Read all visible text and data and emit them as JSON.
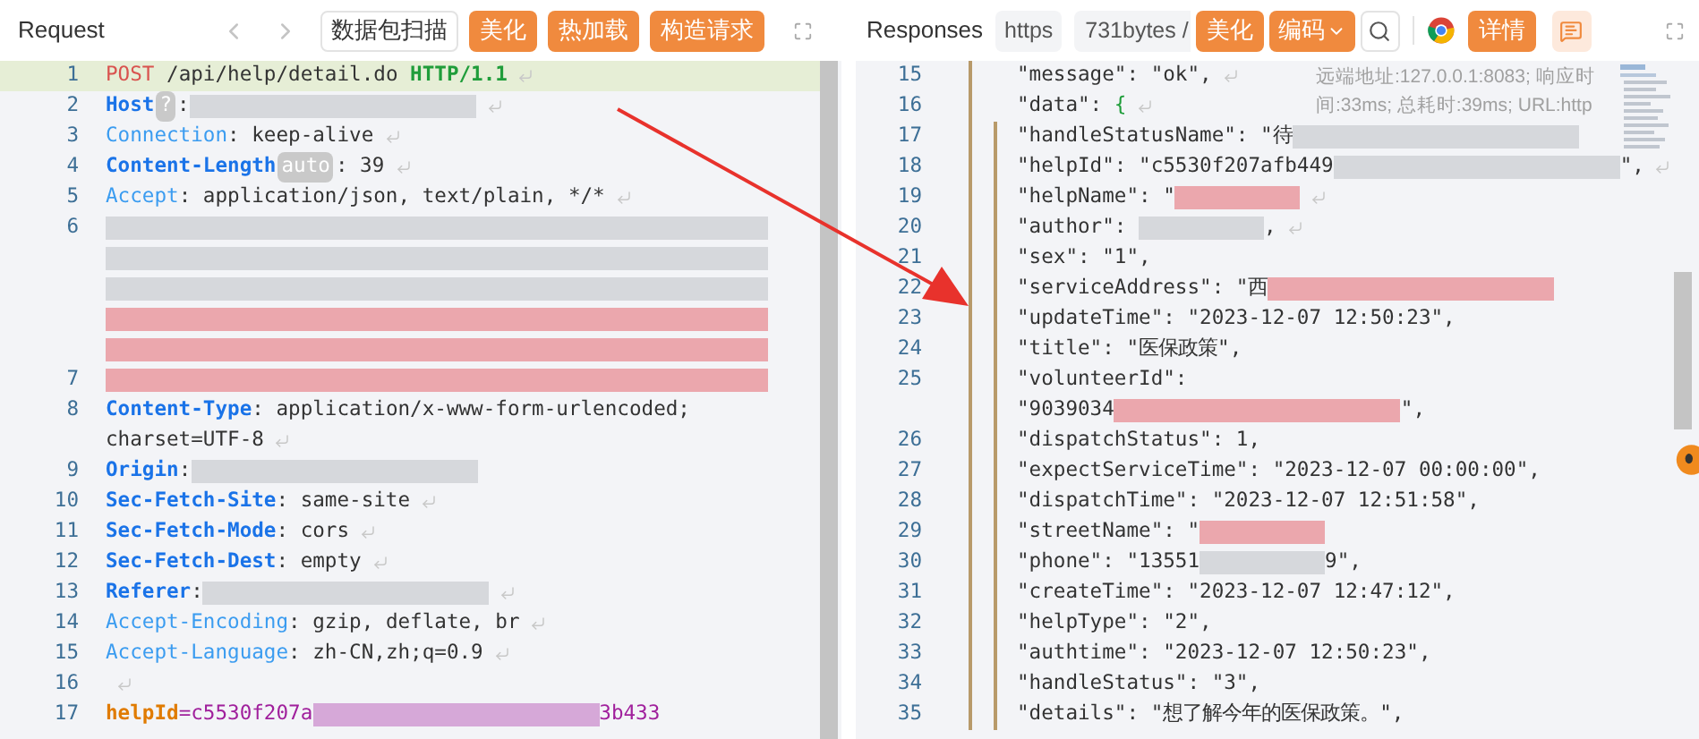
{
  "request": {
    "title": "Request",
    "buttons": [
      {
        "label": "数据包扫描",
        "kind": "outline"
      },
      {
        "label": "美化",
        "kind": "primary"
      },
      {
        "label": "热加载",
        "kind": "primary"
      },
      {
        "label": "构造请求",
        "kind": "primary"
      }
    ],
    "lines": [
      {
        "num": "1",
        "current": true,
        "eol": true,
        "segments": [
          {
            "kind": "method",
            "text": "POST"
          },
          {
            "kind": "text",
            "text": " /api/help/detail.do "
          },
          {
            "kind": "proto",
            "text": "HTTP/1.1"
          }
        ]
      },
      {
        "num": "2",
        "current": false,
        "eol": true,
        "segments": [
          {
            "kind": "key",
            "text": "Host"
          },
          {
            "kind": "badge",
            "text": "?"
          },
          {
            "kind": "text",
            "text": ":"
          },
          {
            "kind": "mask",
            "color": "#d6d8dc"
          }
        ]
      },
      {
        "num": "3",
        "current": false,
        "eol": true,
        "segments": [
          {
            "kind": "keylight",
            "text": "Connection"
          },
          {
            "kind": "text",
            "text": ": keep-alive"
          }
        ]
      },
      {
        "num": "4",
        "current": false,
        "eol": true,
        "segments": [
          {
            "kind": "key",
            "text": "Content-Length"
          },
          {
            "kind": "badge",
            "text": "auto"
          },
          {
            "kind": "text",
            "text": ": 39"
          }
        ]
      },
      {
        "num": "5",
        "current": false,
        "eol": true,
        "segments": [
          {
            "kind": "keylight",
            "text": "Accept"
          },
          {
            "kind": "text",
            "text": ": application/json, text/plain, */*"
          }
        ]
      },
      {
        "num": "6",
        "current": false,
        "eol": false,
        "segments": [
          {
            "kind": "mask_full",
            "color": "#d6d8dc"
          }
        ],
        "wraps": [
          {
            "eol": false,
            "segments": [
              {
                "kind": "mask_full",
                "color": "#d6d8dc"
              }
            ]
          },
          {
            "eol": false,
            "segments": [
              {
                "kind": "mask_full",
                "color": "#d6d8dc"
              }
            ]
          },
          {
            "eol": false,
            "segments": [
              {
                "kind": "mask_full",
                "color": "#eba7ad"
              }
            ]
          },
          {
            "eol": false,
            "segments": [
              {
                "kind": "mask_full",
                "color": "#eba7ad"
              }
            ]
          }
        ]
      },
      {
        "num": "7",
        "current": false,
        "eol": false,
        "segments": [
          {
            "kind": "mask_full",
            "color": "#eba7ad"
          }
        ]
      },
      {
        "num": "8",
        "current": false,
        "eol": false,
        "segments": [
          {
            "kind": "key",
            "text": "Content-Type"
          },
          {
            "kind": "text",
            "text": ": application/x-www-form-urlencoded; "
          }
        ],
        "wraps": [
          {
            "eol": true,
            "segments": [
              {
                "kind": "text",
                "text": "charset=UTF-8"
              }
            ]
          }
        ]
      },
      {
        "num": "9",
        "current": false,
        "eol": false,
        "segments": [
          {
            "kind": "key",
            "text": "Origin"
          },
          {
            "kind": "text",
            "text": ":"
          },
          {
            "kind": "mask",
            "color": "#d6d8dc"
          }
        ]
      },
      {
        "num": "10",
        "current": false,
        "eol": true,
        "segments": [
          {
            "kind": "key",
            "text": "Sec-Fetch-Site"
          },
          {
            "kind": "text",
            "text": ": same-site"
          }
        ]
      },
      {
        "num": "11",
        "current": false,
        "eol": true,
        "segments": [
          {
            "kind": "key",
            "text": "Sec-Fetch-Mode"
          },
          {
            "kind": "text",
            "text": ": cors"
          }
        ]
      },
      {
        "num": "12",
        "current": false,
        "eol": true,
        "segments": [
          {
            "kind": "key",
            "text": "Sec-Fetch-Dest"
          },
          {
            "kind": "text",
            "text": ": empty"
          }
        ]
      },
      {
        "num": "13",
        "current": false,
        "eol": true,
        "segments": [
          {
            "kind": "key",
            "text": "Referer"
          },
          {
            "kind": "text",
            "text": ":"
          },
          {
            "kind": "mask",
            "color": "#d6d8dc"
          }
        ]
      },
      {
        "num": "14",
        "current": false,
        "eol": true,
        "segments": [
          {
            "kind": "keylight",
            "text": "Accept-Encoding"
          },
          {
            "kind": "text",
            "text": ": gzip, deflate, br"
          }
        ]
      },
      {
        "num": "15",
        "current": false,
        "eol": true,
        "segments": [
          {
            "kind": "keylight",
            "text": "Accept-Language"
          },
          {
            "kind": "text",
            "text": ": zh-CN,zh;q=0.9"
          }
        ]
      },
      {
        "num": "16",
        "current": false,
        "eol": true
      },
      {
        "num": "17",
        "current": false,
        "eol": false,
        "segments": [
          {
            "kind": "param",
            "text": "helpId"
          },
          {
            "kind": "value",
            "text": "=c5530f207a"
          },
          {
            "kind": "mask",
            "color": "#d6a8d8"
          },
          {
            "kind": "value",
            "text": "3b433"
          }
        ]
      }
    ]
  },
  "response": {
    "title": "Responses",
    "chips": [
      "https",
      "731bytes /"
    ],
    "buttons": [
      {
        "label": "美化",
        "kind": "primary"
      },
      {
        "label": "编码",
        "kind": "dropdown"
      }
    ],
    "detail_button": "详情",
    "info": [
      "远端地址:127.0.0.1:8083; 响应时",
      "间:33ms; 总耗时:39ms; URL:http"
    ],
    "lines": [
      {
        "num": "15",
        "eol": true,
        "segments": [
          {
            "kind": "text",
            "text": "\"message\": \"ok\","
          }
        ]
      },
      {
        "num": "16",
        "eol": true,
        "segments": [
          {
            "kind": "text",
            "text": "\"data\": "
          },
          {
            "kind": "brace",
            "text": "{"
          }
        ],
        "children": [
          {
            "num": "17",
            "eol": false,
            "segments": [
              {
                "kind": "text",
                "text": "\"handleStatusName\": \"待"
              },
              {
                "kind": "mask",
                "color": "#d6d8dc"
              }
            ]
          },
          {
            "num": "18",
            "eol": true,
            "segments": [
              {
                "kind": "text",
                "text": "\"helpId\": \"c5530f207afb449"
              },
              {
                "kind": "mask",
                "color": "#d6d8dc"
              },
              {
                "kind": "text",
                "text": "\","
              }
            ]
          },
          {
            "num": "19",
            "eol": true,
            "segments": [
              {
                "kind": "text",
                "text": "\"helpName\": \""
              },
              {
                "kind": "mask_short",
                "color": "#eba7ad"
              }
            ]
          },
          {
            "num": "20",
            "eol": true,
            "segments": [
              {
                "kind": "text",
                "text": "\"author\": "
              },
              {
                "kind": "mask_short",
                "color": "#d6d8dc"
              },
              {
                "kind": "text",
                "text": ","
              }
            ]
          },
          {
            "num": "21",
            "eol": false,
            "segments": [
              {
                "kind": "text",
                "text": "\"sex\": \"1\","
              }
            ]
          },
          {
            "num": "22",
            "eol": false,
            "segments": [
              {
                "kind": "text",
                "text": "\"serviceAddress\": \"西"
              },
              {
                "kind": "mask",
                "color": "#eba7ad"
              }
            ]
          },
          {
            "num": "23",
            "eol": false,
            "segments": [
              {
                "kind": "text",
                "text": "\"updateTime\": \"2023-12-07 12:50:23\","
              }
            ]
          },
          {
            "num": "24",
            "eol": false,
            "segments": [
              {
                "kind": "text",
                "text": "\"title\": \"医保政策\","
              }
            ]
          },
          {
            "num": "25",
            "eol": false,
            "segments": [
              {
                "kind": "text",
                "text": "\"volunteerId\": "
              }
            ],
            "wraps": [
              {
                "eol": false,
                "segments": [
                  {
                    "kind": "text",
                    "text": "\"9039034"
                  },
                  {
                    "kind": "mask",
                    "color": "#eba7ad"
                  },
                  {
                    "kind": "text",
                    "text": "\","
                  }
                ]
              }
            ]
          },
          {
            "num": "26",
            "eol": false,
            "segments": [
              {
                "kind": "text",
                "text": "\"dispatchStatus\": 1,"
              }
            ]
          },
          {
            "num": "27",
            "eol": false,
            "segments": [
              {
                "kind": "text",
                "text": "\"expectServiceTime\": \"2023-12-07 00:00:00\","
              }
            ]
          },
          {
            "num": "28",
            "eol": false,
            "segments": [
              {
                "kind": "text",
                "text": "\"dispatchTime\": \"2023-12-07 12:51:58\","
              }
            ]
          },
          {
            "num": "29",
            "eol": false,
            "segments": [
              {
                "kind": "text",
                "text": "\"streetName\": \""
              },
              {
                "kind": "mask_short",
                "color": "#eba7ad"
              }
            ]
          },
          {
            "num": "30",
            "eol": false,
            "segments": [
              {
                "kind": "text",
                "text": "\"phone\": \"13551"
              },
              {
                "kind": "mask_short",
                "color": "#d6d8dc"
              },
              {
                "kind": "text",
                "text": "9\","
              }
            ]
          },
          {
            "num": "31",
            "eol": false,
            "segments": [
              {
                "kind": "text",
                "text": "\"createTime\": \"2023-12-07 12:47:12\","
              }
            ]
          },
          {
            "num": "32",
            "eol": false,
            "segments": [
              {
                "kind": "text",
                "text": "\"helpType\": \"2\","
              }
            ]
          },
          {
            "num": "33",
            "eol": false,
            "segments": [
              {
                "kind": "text",
                "text": "\"authtime\": \"2023-12-07 12:50:23\","
              }
            ]
          },
          {
            "num": "34",
            "eol": false,
            "segments": [
              {
                "kind": "text",
                "text": "\"handleStatus\": \"3\","
              }
            ]
          },
          {
            "num": "35",
            "eol": false,
            "segments": [
              {
                "kind": "text",
                "text": "\"details\": \"想了解今年的医保政策。\","
              }
            ]
          }
        ]
      }
    ]
  }
}
